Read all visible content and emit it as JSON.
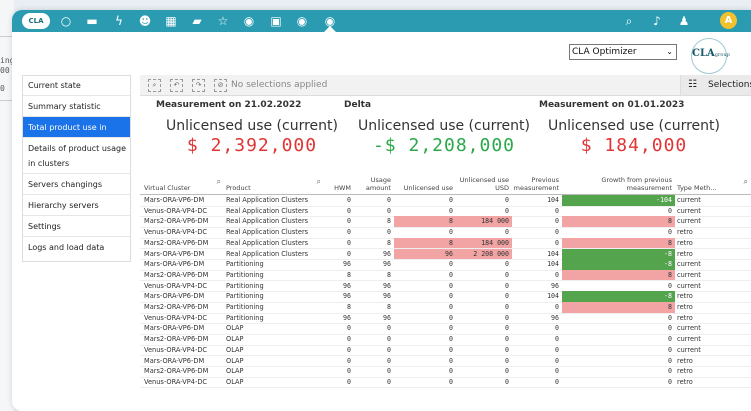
{
  "bg_fragments": [
    "ing",
    "00",
    "0"
  ],
  "topbar": {
    "logo": "CLA",
    "icons": [
      "circle-icon",
      "folder-icon",
      "bolt-icon",
      "users-icon",
      "calendar-icon",
      "briefcase-icon",
      "star-icon",
      "globe-icon",
      "grid-icon",
      "globe-icon",
      "globe-active-icon"
    ],
    "right_icons": [
      "search-icon",
      "bell-icon",
      "user-icon"
    ],
    "avatar_letter": "A",
    "accent": "#2a9bb0"
  },
  "header": {
    "select_value": "CLA Optimizer",
    "brand": "CLA",
    "brand_sub": "group"
  },
  "sidebar": {
    "items": [
      {
        "label": "Current state"
      },
      {
        "label": "Summary statistic"
      },
      {
        "label": "Total product use in clusters",
        "active": true
      },
      {
        "label": "Details of product usage in clusters"
      },
      {
        "label": "Servers changings"
      },
      {
        "label": "Hierarchy servers"
      },
      {
        "label": "Settings"
      },
      {
        "label": "Logs and load data"
      }
    ]
  },
  "toolbar": {
    "no_selections": "No selections applied",
    "selections_label": "Selections"
  },
  "kpis": [
    {
      "label": "Measurement on 21.02.2022",
      "title": "Unlicensed use (current)",
      "value": "$ 2,392,000",
      "color": "#e03535"
    },
    {
      "label": "Delta",
      "title": "Unlicensed use (current)",
      "value": "-$ 2,208,000",
      "color": "#2aa84a"
    },
    {
      "label": "Measurement on 01.01.2023",
      "title": "Unlicensed use (current)",
      "value": "$ 184,000",
      "color": "#e03535"
    }
  ],
  "table": {
    "headers": [
      "Virtual Cluster",
      "Product",
      "HWM",
      "Usage amount",
      "Unlicensed use",
      "Unlicensed use USD",
      "Previous measurement",
      "Growth from previous measurement",
      "Type Meth..."
    ],
    "rows": [
      [
        "Mars-ORA-VP6-DM",
        "Real Application Clusters",
        "0",
        "0",
        "0",
        "0",
        "104",
        "-104",
        "current"
      ],
      [
        "Venus-ORA-VP4-DC",
        "Real Application Clusters",
        "0",
        "0",
        "0",
        "0",
        "0",
        "0",
        "current"
      ],
      [
        "Mars2-ORA-VP6-DM",
        "Real Application Clusters",
        "0",
        "8",
        "8",
        "184 000",
        "0",
        "8",
        "current"
      ],
      [
        "Venus-ORA-VP4-DC",
        "Real Application Clusters",
        "0",
        "0",
        "0",
        "0",
        "0",
        "0",
        "retro"
      ],
      [
        "Mars2-ORA-VP6-DM",
        "Real Application Clusters",
        "0",
        "8",
        "8",
        "184 000",
        "0",
        "8",
        "retro"
      ],
      [
        "Mars-ORA-VP6-DM",
        "Real Application Clusters",
        "0",
        "96",
        "96",
        "2 208 000",
        "104",
        "-8",
        "retro"
      ],
      [
        "Mars-ORA-VP6-DM",
        "Partitioning",
        "96",
        "96",
        "0",
        "0",
        "104",
        "-8",
        "current"
      ],
      [
        "Mars2-ORA-VP6-DM",
        "Partitioning",
        "8",
        "8",
        "0",
        "0",
        "0",
        "8",
        "current"
      ],
      [
        "Venus-ORA-VP4-DC",
        "Partitioning",
        "96",
        "96",
        "0",
        "0",
        "96",
        "0",
        "current"
      ],
      [
        "Mars-ORA-VP6-DM",
        "Partitioning",
        "96",
        "96",
        "0",
        "0",
        "104",
        "-8",
        "retro"
      ],
      [
        "Mars2-ORA-VP6-DM",
        "Partitioning",
        "8",
        "8",
        "0",
        "0",
        "0",
        "8",
        "retro"
      ],
      [
        "Venus-ORA-VP4-DC",
        "Partitioning",
        "96",
        "96",
        "0",
        "0",
        "96",
        "0",
        "retro"
      ],
      [
        "Mars-ORA-VP6-DM",
        "OLAP",
        "0",
        "0",
        "0",
        "0",
        "0",
        "0",
        "current"
      ],
      [
        "Mars2-ORA-VP6-DM",
        "OLAP",
        "0",
        "0",
        "0",
        "0",
        "0",
        "0",
        "current"
      ],
      [
        "Venus-ORA-VP4-DC",
        "OLAP",
        "0",
        "0",
        "0",
        "0",
        "0",
        "0",
        "current"
      ],
      [
        "Mars-ORA-VP6-DM",
        "OLAP",
        "0",
        "0",
        "0",
        "0",
        "0",
        "0",
        "retro"
      ],
      [
        "Mars2-ORA-VP6-DM",
        "OLAP",
        "0",
        "0",
        "0",
        "0",
        "0",
        "0",
        "retro"
      ],
      [
        "Venus-ORA-VP4-DC",
        "OLAP",
        "0",
        "0",
        "0",
        "0",
        "0",
        "0",
        "retro"
      ]
    ],
    "highlight_colors": {
      "red": "#f2a3a3",
      "green": "#54a34d"
    }
  }
}
